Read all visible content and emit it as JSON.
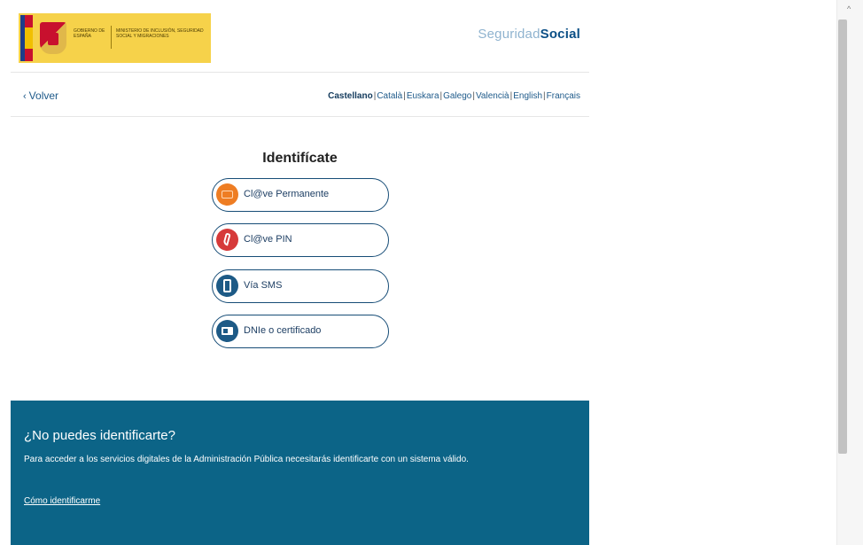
{
  "header": {
    "gov_logo_left_text": "GOBIERNO DE ESPAÑA",
    "gov_logo_right_text": "MINISTERIO DE INCLUSIÓN, SEGURIDAD SOCIAL Y MIGRACIONES",
    "brand_part1": "Seguridad",
    "brand_part2": "Social"
  },
  "nav": {
    "back_label": "Volver",
    "languages": [
      "Castellano",
      "Català",
      "Euskara",
      "Galego",
      "Valencià",
      "English",
      "Français"
    ],
    "active_language": "Castellano"
  },
  "identify": {
    "title": "Identifícate",
    "options": [
      {
        "label": "Cl@ve Permanente",
        "icon": "key-card-icon"
      },
      {
        "label": "Cl@ve PIN",
        "icon": "pin-icon"
      },
      {
        "label": "Vía SMS",
        "icon": "phone-icon"
      },
      {
        "label": "DNIe o certificado",
        "icon": "certificate-icon"
      }
    ]
  },
  "help_panel": {
    "title": "¿No puedes identificarte?",
    "description": "Para acceder a los servicios digitales de la Administración Pública necesitarás identificarte con un sistema válido.",
    "link": "Cómo identificarme"
  },
  "colors": {
    "panel_bg": "#0c6487",
    "brand_dark": "#0b4f86",
    "brand_light": "#8fb3cf",
    "button_border": "#174d77"
  }
}
